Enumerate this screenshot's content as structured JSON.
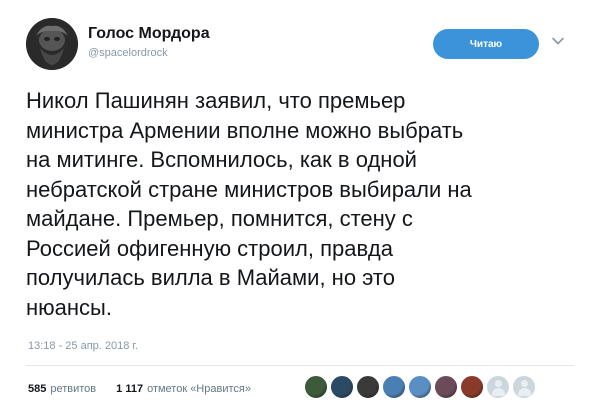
{
  "author": {
    "name": "Голос Мордора",
    "handle": "@spacelordrock",
    "avatar_icon": "avatar-icon"
  },
  "follow_button": {
    "label": "Читаю",
    "color": "#3b94d9"
  },
  "more_icon": "chevron-down-icon",
  "tweet": {
    "text": "Никол Пашинян заявил, что премьер\nминистра Армении вполне можно выбрать\nна митинге. Вспомнилось, как в одной\nнебратской стране министров выбирали на\nмайдане. Премьер, помнится, стену с\nРоссией офигенную строил, правда\nполучилась вилла в Майами, но это\nнюансы.",
    "timestamp": "13:18 - 25 апр. 2018 г."
  },
  "stats": {
    "retweets_count": "585",
    "retweets_label": "ретвитов",
    "likes_count": "1 117",
    "likes_label": "отметок «Нравится»"
  },
  "likers": {
    "colors": [
      "#3d5a3a",
      "#2c4a66",
      "#3a3a3a",
      "#4a7fb3",
      "#5a8fc4",
      "#6b4a5a",
      "#8a3a2a",
      "#ccd6dd",
      "#ccd6dd"
    ]
  }
}
